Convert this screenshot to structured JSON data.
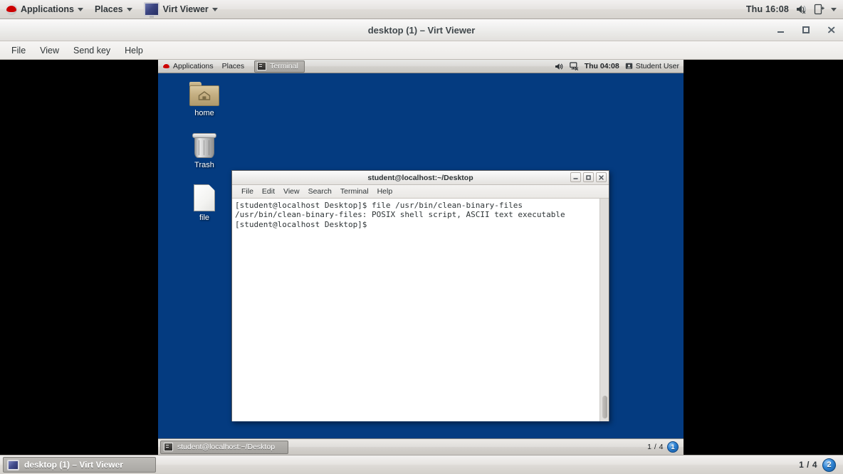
{
  "host": {
    "panel": {
      "applications_label": "Applications",
      "places_label": "Places",
      "active_app_label": "Virt Viewer",
      "clock": "Thu 16:08"
    },
    "window": {
      "title": "desktop (1) – Virt Viewer",
      "minimize_label": "–",
      "maximize_label": "□",
      "close_label": "✕",
      "menu": [
        "File",
        "View",
        "Send key",
        "Help"
      ]
    },
    "taskbar": {
      "items": [
        {
          "label": "desktop (1) – Virt Viewer",
          "icon": "display-icon"
        }
      ],
      "workspace_count": "1 / 4",
      "workspace_current": "2"
    }
  },
  "guest": {
    "panel": {
      "applications_label": "Applications",
      "places_label": "Places",
      "window_button_label": "Terminal",
      "clock": "Thu 04:08",
      "user_label": "Student User"
    },
    "desktop_icons": [
      {
        "label": "home",
        "icon": "home-folder-icon"
      },
      {
        "label": "Trash",
        "icon": "trash-icon"
      },
      {
        "label": "file",
        "icon": "document-icon"
      }
    ],
    "terminal": {
      "title": "student@localhost:~/Desktop",
      "menu": [
        "File",
        "Edit",
        "View",
        "Search",
        "Terminal",
        "Help"
      ],
      "minimize_label": "–",
      "maximize_label": "□",
      "close_label": "✕",
      "lines": [
        "[student@localhost Desktop]$ file /usr/bin/clean-binary-files",
        "/usr/bin/clean-binary-files: POSIX shell script, ASCII text executable",
        "[student@localhost Desktop]$ "
      ],
      "content": "[student@localhost Desktop]$ file /usr/bin/clean-binary-files\n/usr/bin/clean-binary-files: POSIX shell script, ASCII text executable\n[student@localhost Desktop]$ "
    },
    "taskbar": {
      "items": [
        {
          "label": "student@localhost:~/Desktop",
          "icon": "terminal-icon"
        }
      ],
      "workspace_count": "1 / 4",
      "workspace_current": "1"
    }
  },
  "colors": {
    "desktop_blue": "#043b80",
    "panel_grey": "#dcdbd8",
    "terminal_bg": "#ffffff",
    "terminal_fg": "#2e3436",
    "accent_blue": "#2a7fd0",
    "brand_red": "#cc0000"
  }
}
